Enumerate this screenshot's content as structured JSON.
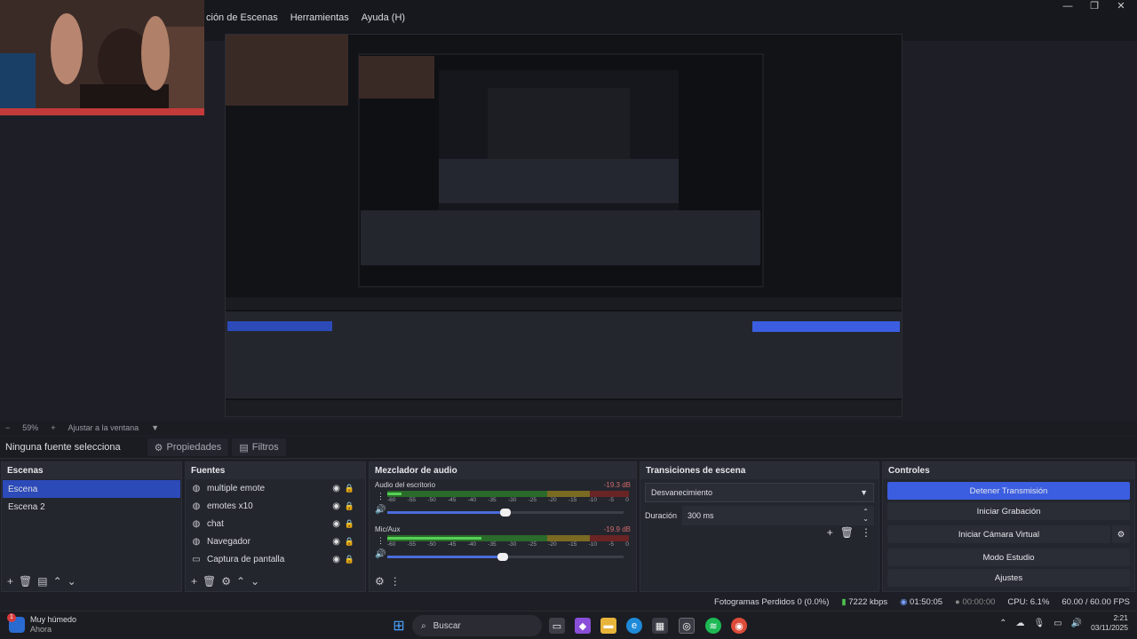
{
  "menu": {
    "items": [
      "ción de Escenas",
      "Herramientas",
      "Ayuda (H)"
    ]
  },
  "window_controls": {
    "minimize": "—",
    "maximize": "❐",
    "close": "✕"
  },
  "zoom": {
    "level": "59%",
    "fit_label": "Ajustar a la ventana"
  },
  "source_toolbar": {
    "selected_label": "Ninguna fuente selecciona",
    "properties_label": "Propiedades",
    "filters_label": "Filtros"
  },
  "scenes": {
    "title": "Escenas",
    "items": [
      "Escena",
      "Escena 2"
    ]
  },
  "sources": {
    "title": "Fuentes",
    "items": [
      "multiple emote",
      "emotes x10",
      "chat",
      "Navegador",
      "Captura de pantalla"
    ]
  },
  "mixer": {
    "title": "Mezclador de audio",
    "tracks": [
      {
        "name": "Audio del escritorio",
        "db": "-19.3 dB",
        "level": 0.06,
        "volume": 0.5
      },
      {
        "name": "Mic/Aux",
        "db": "-19.9 dB",
        "level": 0.4,
        "volume": 0.49
      }
    ],
    "ticks": [
      "-60",
      "-55",
      "-50",
      "-45",
      "-40",
      "-35",
      "-30",
      "-25",
      "-20",
      "-15",
      "-10",
      "-5",
      "0"
    ]
  },
  "transitions": {
    "title": "Transiciones de escena",
    "selected": "Desvanecimiento",
    "duration_label": "Duración",
    "duration_value": "300 ms"
  },
  "controls": {
    "title": "Controles",
    "stop_stream": "Detener Transmisión",
    "start_recording": "Iniciar Grabación",
    "start_virtual_cam": "Iniciar Cámara Virtual",
    "studio_mode": "Modo Estudio",
    "settings": "Ajustes"
  },
  "status": {
    "dropped_frames": "Fotogramas Perdidos 0 (0.0%)",
    "bitrate": "7222 kbps",
    "stream_time": "01:50:05",
    "rec_time": "00:00:00",
    "cpu": "CPU: 6.1%",
    "fps": "60.00 / 60.00 FPS"
  },
  "taskbar": {
    "weather_title": "Muy húmedo",
    "weather_sub": "Ahora",
    "weather_badge": "1",
    "search_placeholder": "Buscar",
    "time": "2:21",
    "date": "03/11/2025"
  },
  "colors": {
    "accent": "#3b5ee0",
    "selected_scene": "#2c4ab8",
    "panel": "#24262e",
    "background": "#1e1f26"
  }
}
